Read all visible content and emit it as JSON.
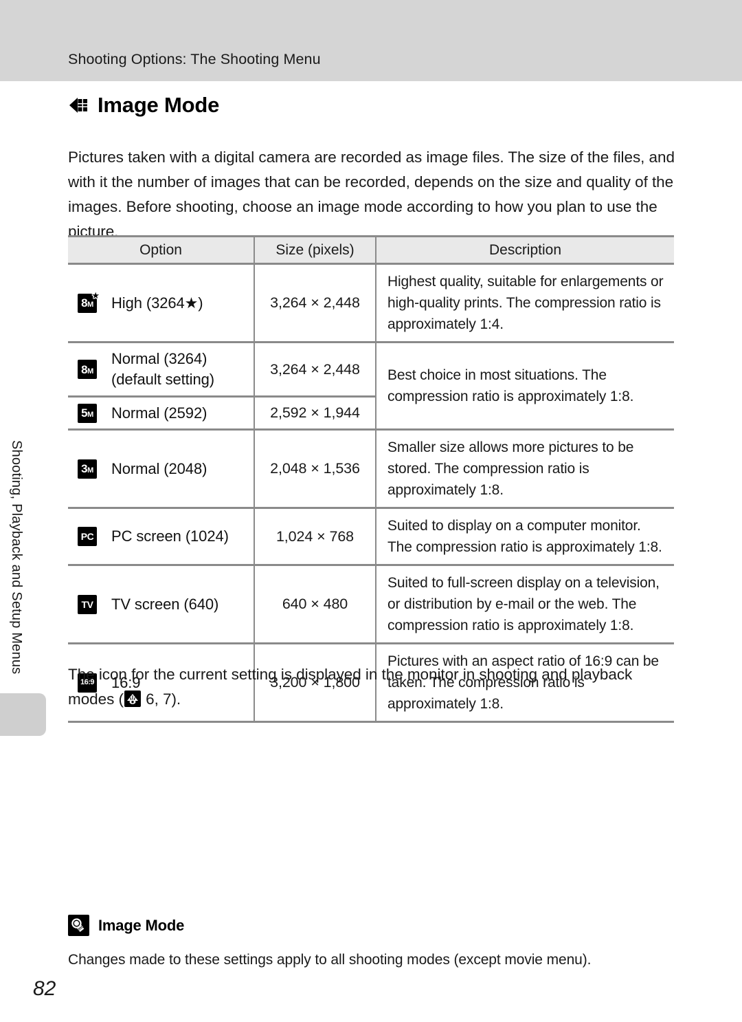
{
  "header": {
    "running_title": "Shooting Options: The Shooting Menu"
  },
  "sidebar": {
    "tab_label": "Shooting, Playback and Setup Menus"
  },
  "section": {
    "icon": "image-mode-arrow-icon",
    "title": "Image Mode"
  },
  "intro": {
    "text": "Pictures taken with a digital camera are recorded as image files. The size of the files, and with it the number of images that can be recorded, depends on the size and quality of the images. Before shooting, choose an image mode according to how you plan to use the picture."
  },
  "table": {
    "headers": [
      "Option",
      "Size (pixels)",
      "Description"
    ],
    "rows": [
      {
        "badge": {
          "big": "8",
          "sml": "M",
          "star": "★",
          "name": "mode-badge-8m-star"
        },
        "option": "High (3264★)",
        "size": "3,264 × 2,448",
        "description": "Highest quality, suitable for enlargements or high-quality prints. The compression ratio is approximately 1:4."
      },
      {
        "badge": {
          "big": "8",
          "sml": "M",
          "star": "",
          "name": "mode-badge-8m"
        },
        "option": "Normal (3264)\n(default setting)",
        "size": "3,264 × 2,448",
        "description": "Best choice in most situations. The compression ratio is approximately 1:8."
      },
      {
        "badge": {
          "big": "5",
          "sml": "M",
          "star": "",
          "name": "mode-badge-5m"
        },
        "option": "Normal (2592)",
        "size": "2,592 × 1,944",
        "description": ""
      },
      {
        "badge": {
          "big": "3",
          "sml": "M",
          "star": "",
          "name": "mode-badge-3m"
        },
        "option": "Normal (2048)",
        "size": "2,048 × 1,536",
        "description": "Smaller size allows more pictures to be stored. The compression ratio is approximately 1:8."
      },
      {
        "badge": {
          "pair": "PC",
          "star": "",
          "name": "mode-badge-pc"
        },
        "option": "PC screen (1024)",
        "size": "1,024 × 768",
        "description": "Suited to display on a computer monitor. The compression ratio is approximately 1:8."
      },
      {
        "badge": {
          "pair": "TV",
          "star": "",
          "name": "mode-badge-tv"
        },
        "option": "TV screen (640)",
        "size": "640 × 480",
        "description": "Suited to full-screen display on a television, or distribution by e-mail or the web. The compression ratio is approximately 1:8."
      },
      {
        "badge": {
          "pair": "16:9",
          "star": "",
          "name": "mode-badge-16-9"
        },
        "option": "16:9",
        "size": "3,200 × 1,800",
        "description": "Pictures with an aspect ratio of 16:9 can be taken. The compression ratio is approximately 1:8."
      }
    ]
  },
  "closing": {
    "text_before": "The icon for the current setting is displayed in the monitor in shooting and playback modes (",
    "icon": "eye-monitor-icon",
    "text_after": " 6, 7)."
  },
  "tip": {
    "icon": "lightbulb-icon",
    "title": "Image Mode",
    "body": "Changes made to these settings apply to all shooting modes (except movie menu)."
  },
  "page": {
    "number": "82"
  },
  "colors": {
    "header_band": "#d5d5d5",
    "table_header_bg": "#e9e9e9",
    "rule": "#8a8a8a",
    "text": "#1a1a1a"
  }
}
